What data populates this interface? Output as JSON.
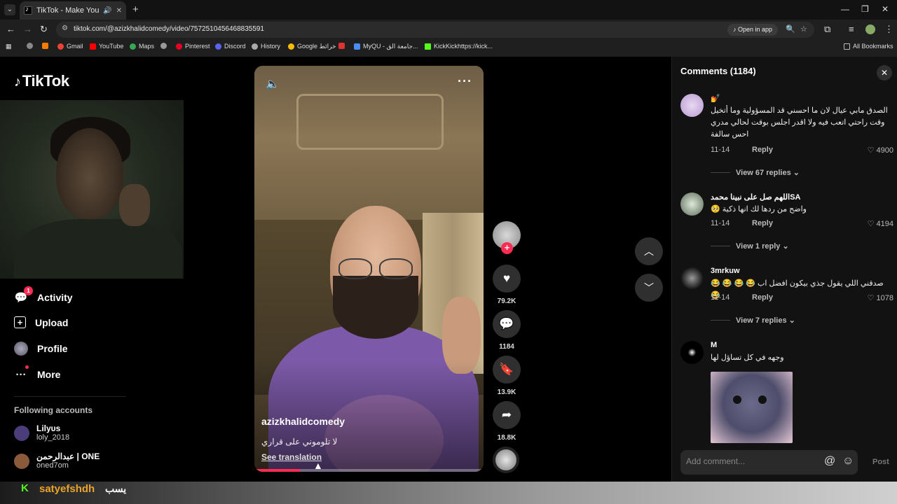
{
  "browser": {
    "tab_title": "TikTok - Make Your Day",
    "url": "tiktok.com/@azizkhalidcomedy/video/7572510456468835591",
    "open_in_app": "Open in app",
    "bookmarks": [
      "Gmail",
      "YouTube",
      "Maps",
      "Pinterest",
      "Discord",
      "History",
      "Google خرائط",
      "MyQU - جامعة الق...",
      "KickKickhttps://kick..."
    ],
    "all_bookmarks": "All Bookmarks"
  },
  "sidebar": {
    "logo": "TikTok",
    "nav": [
      {
        "label": "Activity",
        "icon": "activity-icon",
        "badge": "1"
      },
      {
        "label": "Upload",
        "icon": "upload-icon"
      },
      {
        "label": "Profile",
        "icon": "profile-avatar"
      },
      {
        "label": "More",
        "icon": "more-icon"
      }
    ],
    "following_header": "Following accounts",
    "accounts": [
      {
        "name": "Lilyυs",
        "handle": "loly_2018"
      },
      {
        "name": "عبدالرحمن | ONE",
        "handle": "oned7om"
      }
    ]
  },
  "video": {
    "username": "azizkhalidcomedy",
    "caption": "لا تلوموني على قراري",
    "see_translation": "See translation",
    "progress": 0.2
  },
  "actions": {
    "likes": "79.2K",
    "comments": "1184",
    "saves": "13.9K",
    "shares": "18.8K"
  },
  "comments_panel": {
    "title": "Comments (1184)",
    "items": [
      {
        "user": "💅",
        "text": "الصدق مابي عيال لان ما احسني قد المسؤولية وما أتخيل وقت راحتي اتعب فيه ولا اقدر اجلس بوقت لحالي مدري احس سالفة",
        "date": "11-14",
        "reply": "Reply",
        "likes": "4900",
        "view_replies": "View 67 replies"
      },
      {
        "user": "اللهم صل على نبينا محمدSA",
        "text": "واضح من ردها لك انها ذكية 🥺",
        "date": "11-14",
        "reply": "Reply",
        "likes": "4194",
        "view_replies": "View 1 reply"
      },
      {
        "user": "3mrkuw",
        "text": "صدقني اللي يقول جذي بيكون افضل اب 😂 😂 😂 😂 😂",
        "date": "11-14",
        "reply": "Reply",
        "likes": "1078",
        "view_replies": "View 7 replies"
      },
      {
        "user": "M",
        "text": "وجهه في كل تساؤل لها"
      }
    ],
    "input_placeholder": "Add comment...",
    "post": "Post"
  },
  "overlay": {
    "kick_username": "satyefshdh",
    "kick_suffix": "يسب"
  }
}
